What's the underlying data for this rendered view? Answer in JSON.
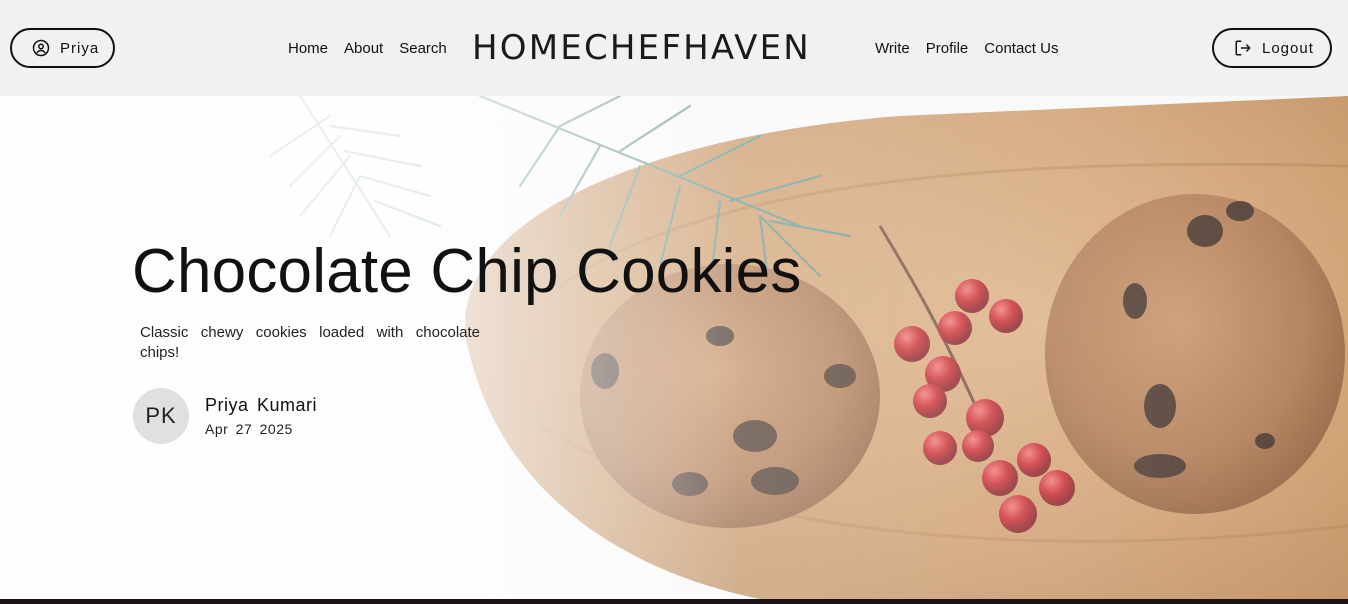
{
  "header": {
    "user_label": "Priya",
    "logout_label": "Logout",
    "brand": "HOMECHEFHAVEN",
    "nav_left": [
      "Home",
      "About",
      "Search"
    ],
    "nav_right": [
      "Write",
      "Profile",
      "Contact Us"
    ]
  },
  "post": {
    "title": "Chocolate Chip Cookies",
    "description": "Classic chewy cookies loaded with chocolate chips!",
    "author_initials": "PK",
    "author_name": "Priya Kumari",
    "date": "Apr 27 2025"
  },
  "icons": {
    "user": "user-circle-icon",
    "logout": "logout-icon"
  },
  "colors": {
    "header_bg": "#f1f1f1",
    "text": "#111111",
    "avatar_bg": "#e0e0e0"
  }
}
